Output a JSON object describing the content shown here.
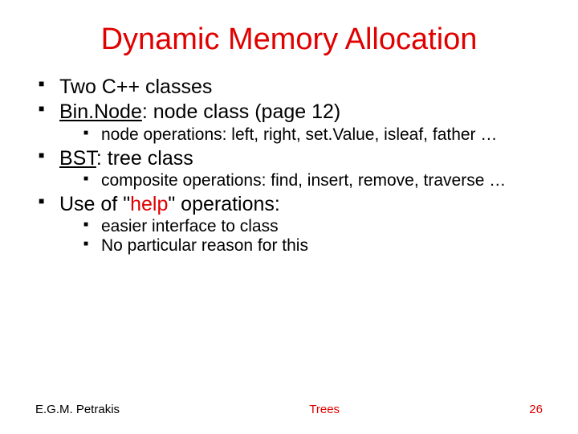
{
  "title": "Dynamic Memory Allocation",
  "bullets": {
    "b1": "Two C++ classes",
    "b2_pre": "Bin.Node",
    "b2_post": ": node class (page 12)",
    "b2_sub1": "node operations: left, right, set.Value, isleaf, father …",
    "b3_pre": "BST",
    "b3_post": ": tree class",
    "b3_sub1": "composite operations: find, insert, remove, traverse …",
    "b4_pre": "Use of \"",
    "b4_help": "help",
    "b4_post": "\" operations:",
    "b4_sub1": "easier interface to class",
    "b4_sub2": "No particular reason for this"
  },
  "footer": {
    "left": "E.G.M. Petrakis",
    "center": "Trees",
    "right": "26"
  }
}
